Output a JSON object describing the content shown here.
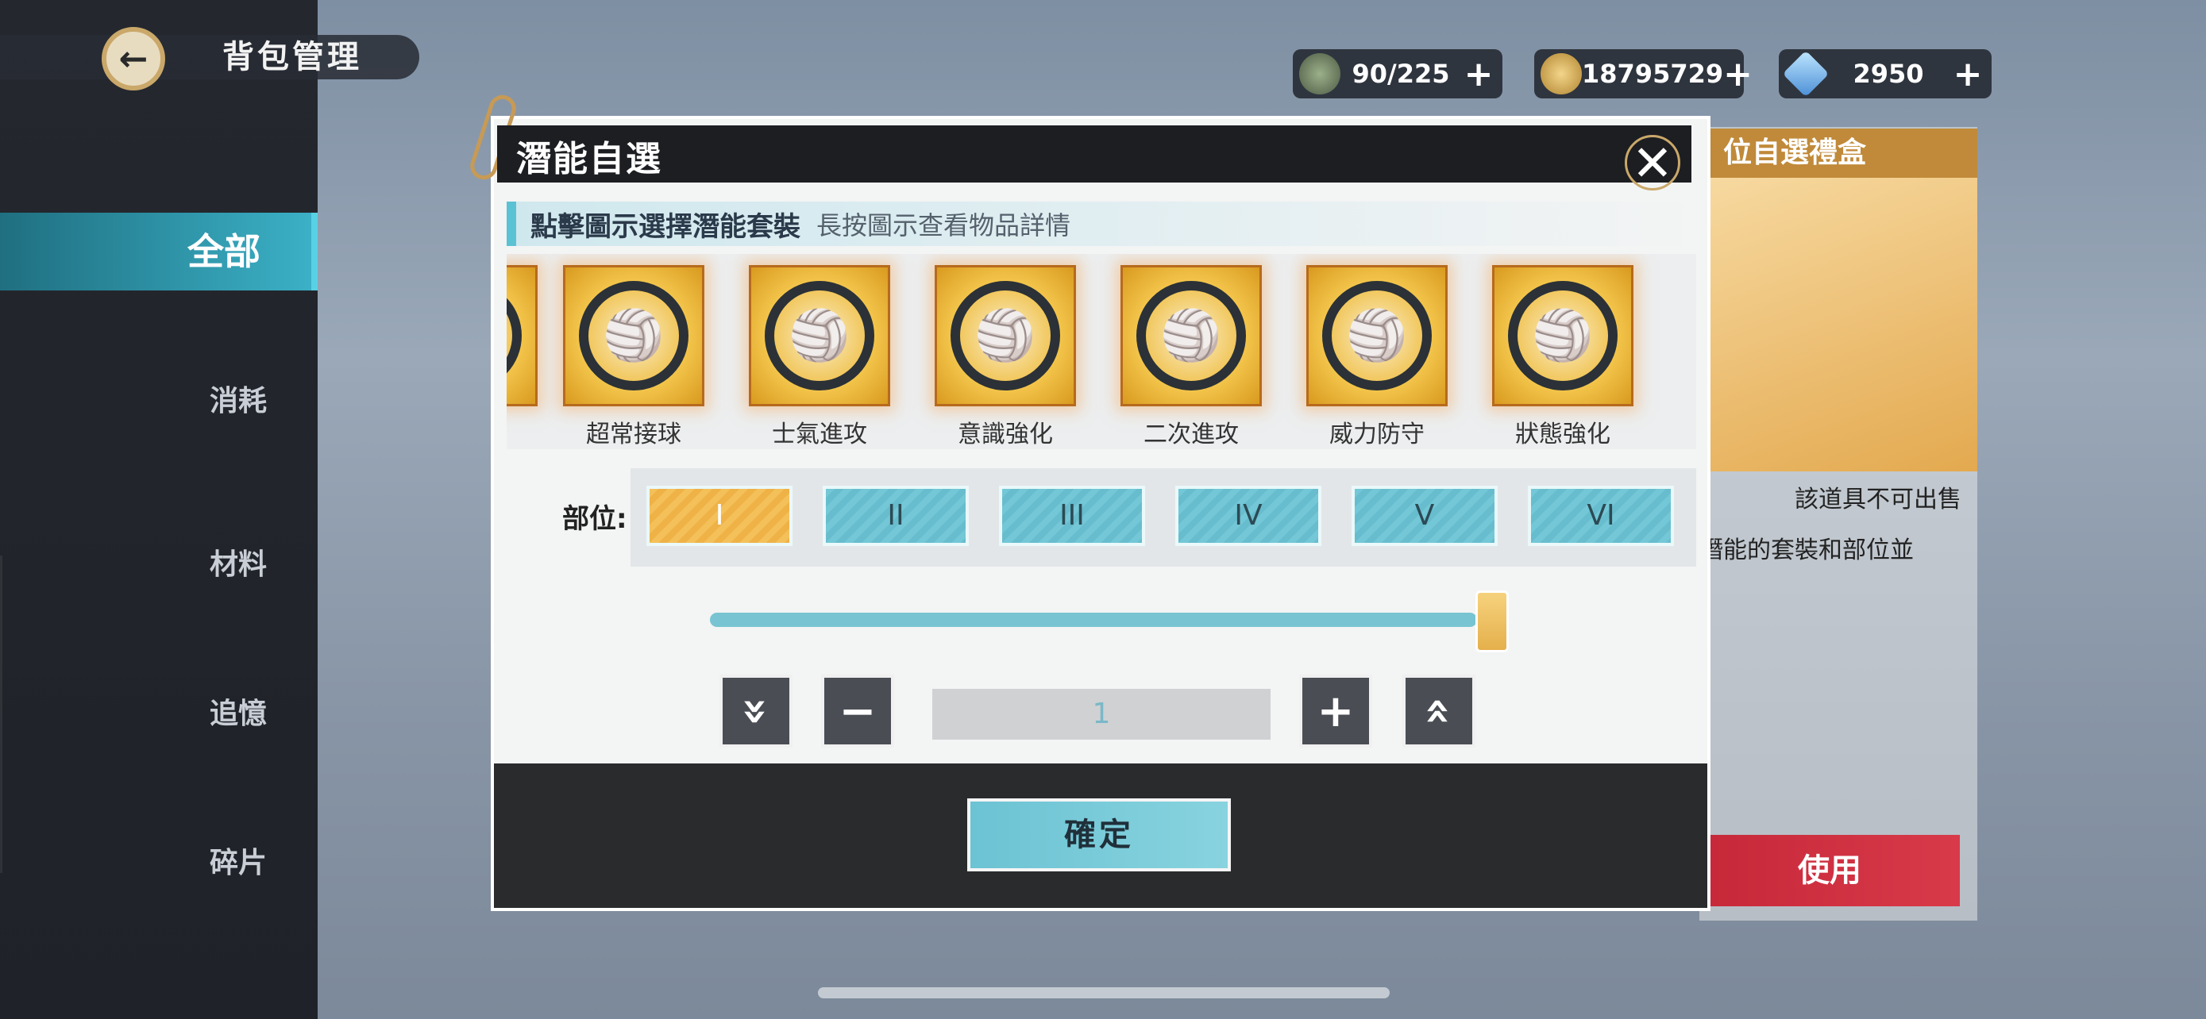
{
  "header": {
    "title": "背包管理",
    "back_icon": "←"
  },
  "sidebar": {
    "items": [
      {
        "label": "全部",
        "active": true
      },
      {
        "label": "消耗",
        "active": false
      },
      {
        "label": "材料",
        "active": false
      },
      {
        "label": "追憶",
        "active": false
      },
      {
        "label": "碎片",
        "active": false
      }
    ]
  },
  "resources": [
    {
      "icon": "tent-icon",
      "value": "90/225",
      "plus": "+"
    },
    {
      "icon": "coin-icon",
      "value": "18795729",
      "plus": "+"
    },
    {
      "icon": "diamond-icon",
      "value": "2950",
      "plus": "+"
    }
  ],
  "background_panel": {
    "gift_title": "位自選禮盒",
    "note": "該道具不可出售",
    "description": "潛能的套裝和部位並",
    "use_button": "使用"
  },
  "dialog": {
    "title": "潛能自選",
    "close_label": "✕",
    "instruction_main": "點擊圖示選擇潛能套裝",
    "instruction_hint": "長按圖示查看物品詳情",
    "sets": [
      {
        "label": "超常接球",
        "glyph": "🏐"
      },
      {
        "label": "士氣進攻",
        "glyph": "🏐"
      },
      {
        "label": "意識強化",
        "glyph": "🏐"
      },
      {
        "label": "二次進攻",
        "glyph": "🏐"
      },
      {
        "label": "威力防守",
        "glyph": "🏐"
      },
      {
        "label": "狀態強化",
        "glyph": "🏐"
      }
    ],
    "parts_label": "部位:",
    "parts": [
      "I",
      "II",
      "III",
      "IV",
      "V",
      "VI"
    ],
    "selected_part": "I",
    "slider_level": 1.0,
    "stepper": {
      "min_label": "»",
      "minus_label": "−",
      "plus_label": "+",
      "max_label": "«",
      "quantity": "1"
    },
    "confirm_label": "確定"
  },
  "colors": {
    "accent": "#5bc2d3",
    "selected": "#f4c05a",
    "use_red": "#c62839"
  }
}
